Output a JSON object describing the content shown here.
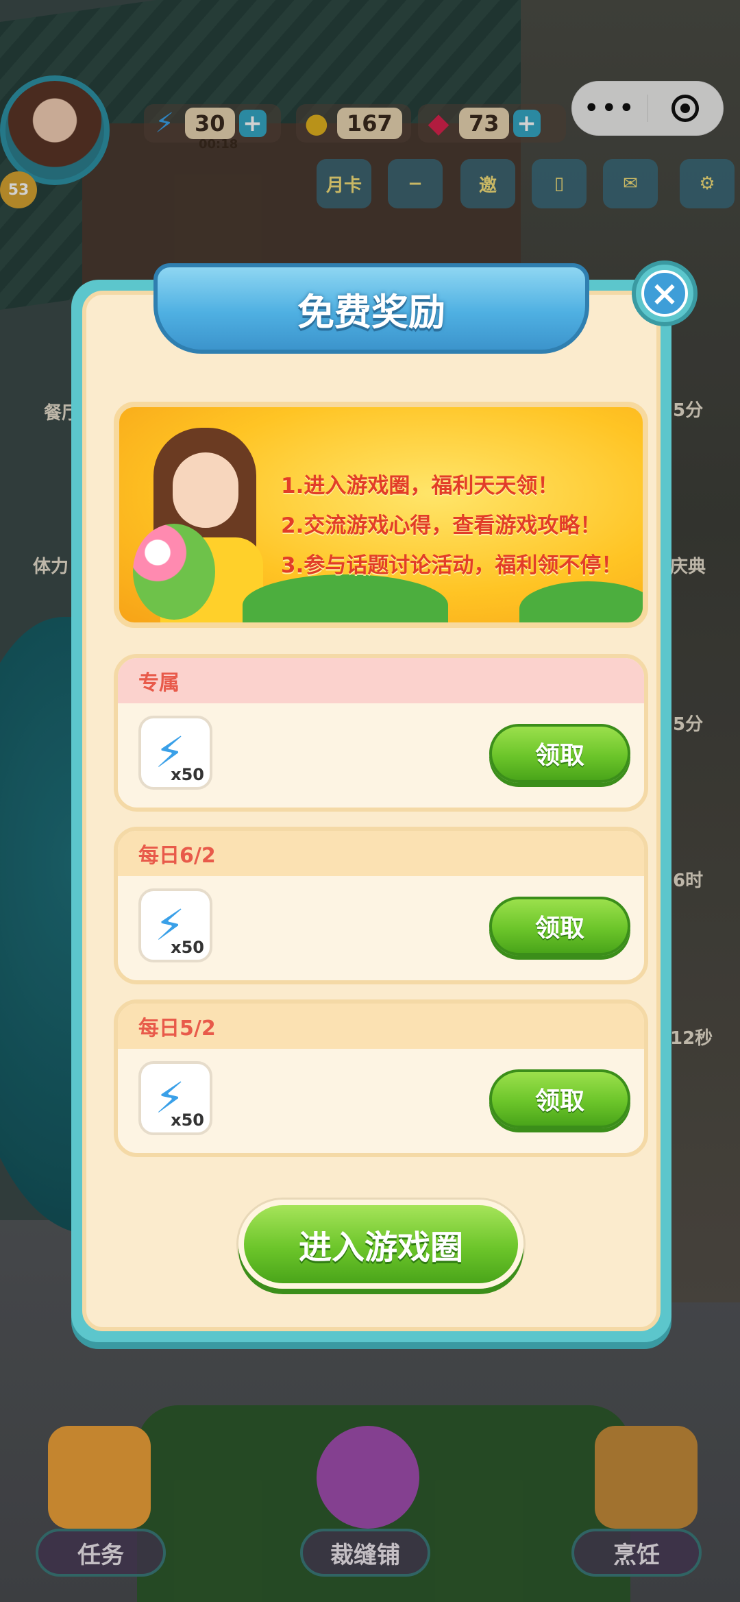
{
  "hud": {
    "level": "53",
    "energy": "30",
    "energy_timer": "00:18",
    "coins": "167",
    "gems": "73",
    "plus": "+",
    "month_card": "月卡",
    "invite": "邀"
  },
  "scene_labels": {
    "left1": "餐厅",
    "left2": "体力",
    "right1": "5分",
    "right2": "庆典",
    "right3": "5分",
    "right4": "6时",
    "right5": "12秒"
  },
  "capsule": {
    "menu": "•••"
  },
  "modal": {
    "title": "免费奖励",
    "close": "×",
    "banner_lines": [
      "1.进入游戏圈，福利天天领！",
      "2.交流游戏心得，查看游戏攻略！",
      "3.参与话题讨论活动，福利领不停！"
    ],
    "rewards": [
      {
        "header": "专属",
        "qty": "x50",
        "button": "领取"
      },
      {
        "header": "每日6/2",
        "qty": "x50",
        "button": "领取"
      },
      {
        "header": "每日5/2",
        "qty": "x50",
        "button": "领取"
      }
    ],
    "enter_button": "进入游戏圈"
  },
  "bottom_nav": {
    "tasks": "任务",
    "tailor": "裁缝铺",
    "cooking": "烹饪"
  }
}
